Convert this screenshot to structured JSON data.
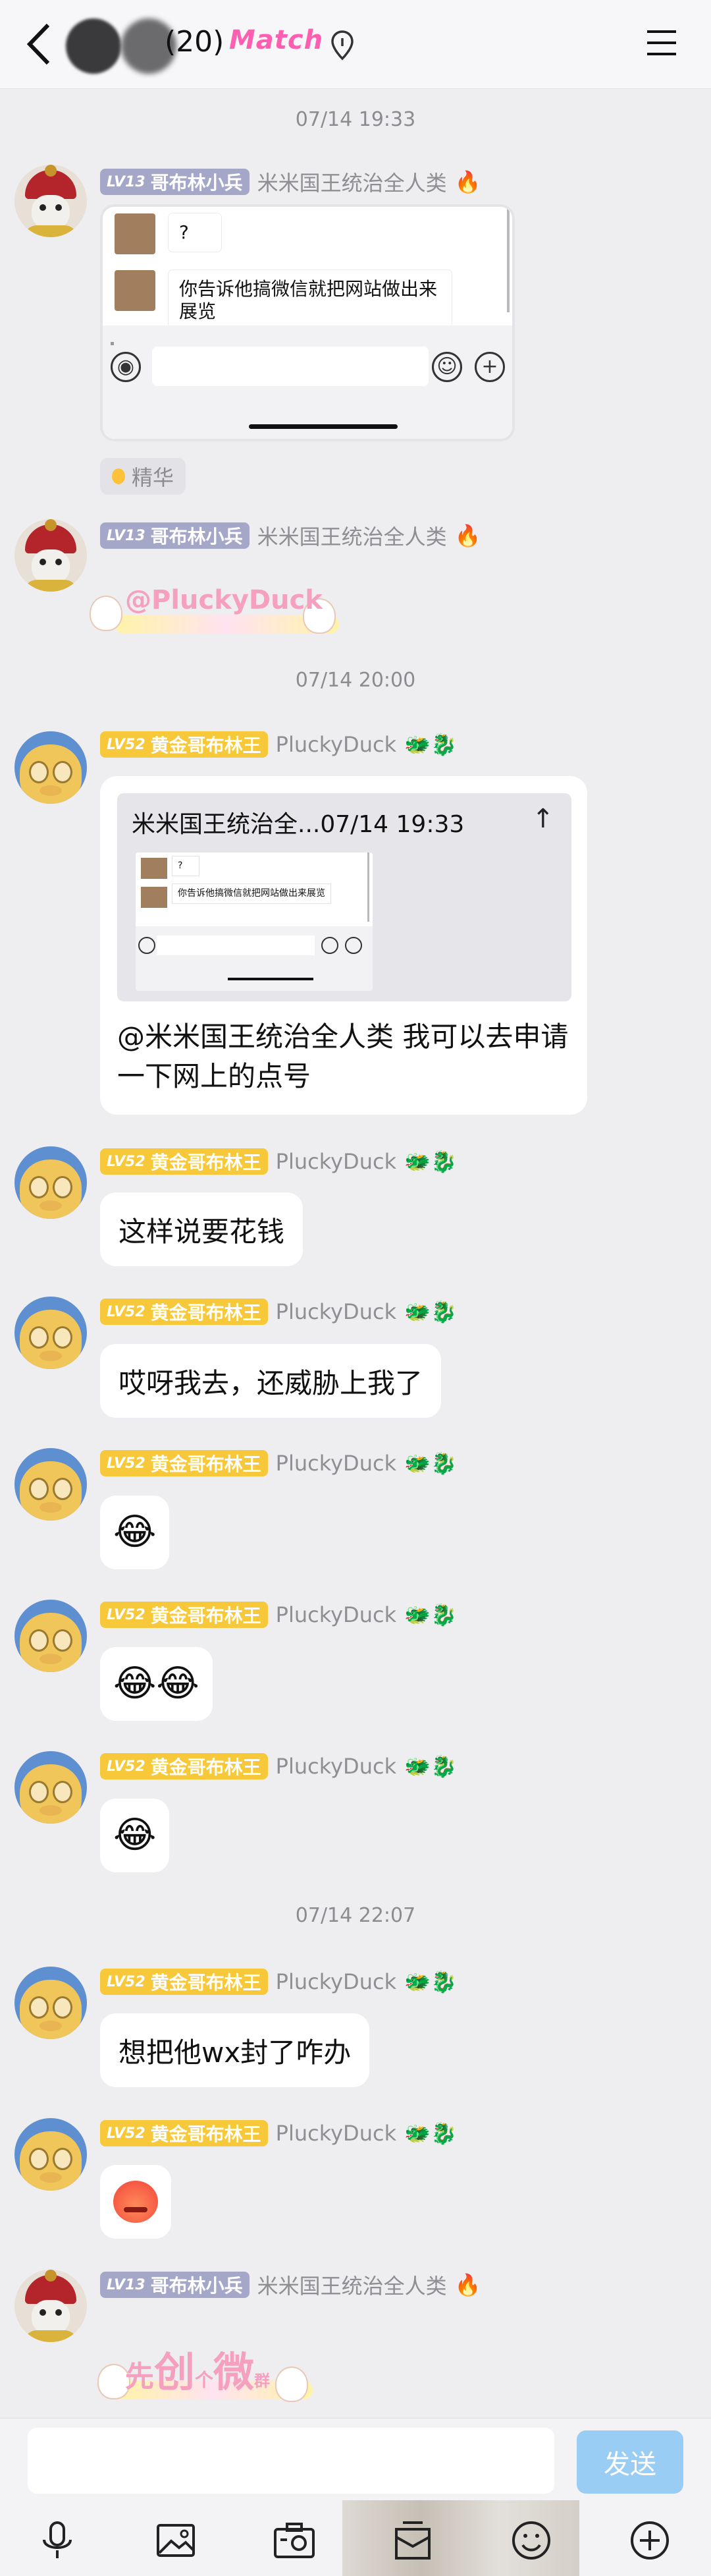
{
  "header": {
    "member_count": "(20)",
    "group_logo_text": "Match",
    "icons": [
      "back-icon",
      "location-pin-icon",
      "menu-icon"
    ]
  },
  "timestamps": [
    "07/14 19:33",
    "07/14 20:00",
    "07/14 22:07"
  ],
  "users": {
    "goblin_soldier": {
      "level": "LV13",
      "title": "哥布林小兵",
      "nickname": "米米国王统治全人类"
    },
    "golden_goblin": {
      "level": "LV52",
      "title": "黄金哥布林王",
      "nickname": "PluckyDuck"
    }
  },
  "messages": {
    "m1": {
      "shot_msg1": "?",
      "shot_msg2": "你告诉他搞微信就把网站做出来展览",
      "tag": "精华"
    },
    "m2": {
      "sticker_text": "@PluckyDuck"
    },
    "m3": {
      "quote_header": "米米国王统治全...07/14 19:33",
      "quote_shot_msg1": "?",
      "quote_shot_msg2": "你告诉他搞微信就把网站做出来展览",
      "text": "@米米国王统治全人类 我可以去申请一下网上的点号"
    },
    "m4": {
      "text": "这样说要花钱"
    },
    "m5": {
      "text": "哎呀我去，还威胁上我了"
    },
    "m6": {
      "emoji": "😂"
    },
    "m7": {
      "emoji": "😂😂"
    },
    "m8": {
      "emoji": "😂"
    },
    "m9": {
      "text": "想把他wx封了咋办"
    },
    "m10": {
      "emoji_name": "angry-face"
    },
    "m11": {
      "sticker_t1": "先",
      "sticker_t2": "创",
      "sticker_t3": "个",
      "sticker_t4": "微",
      "sticker_t5": "群"
    }
  },
  "composer": {
    "send_label": "发送"
  },
  "toolbar_icons": [
    "microphone-icon",
    "image-icon",
    "camera-icon",
    "gift-icon",
    "emoji-icon",
    "add-icon"
  ],
  "colors": {
    "gold_badge": "#f7c93a",
    "grey_badge": "#a5a7c8",
    "send_button": "#99cdf3",
    "logo_pink": "#ff5fb0"
  }
}
